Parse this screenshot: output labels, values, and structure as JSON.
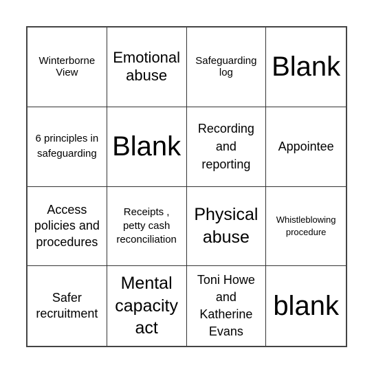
{
  "board": {
    "rows": [
      [
        "Winterborne View",
        "Emotional abuse",
        "Safeguarding log",
        "Blank"
      ],
      [
        "6 principles in safeguarding",
        "Blank",
        "Recording and reporting",
        "Appointee"
      ],
      [
        "Access policies and procedures",
        "Receipts , petty cash reconciliation",
        "Physical abuse",
        "Whistleblowing procedure"
      ],
      [
        "Safer recruitment",
        "Mental capacity act",
        "Toni Howe and Katherine Evans",
        "blank"
      ]
    ]
  }
}
